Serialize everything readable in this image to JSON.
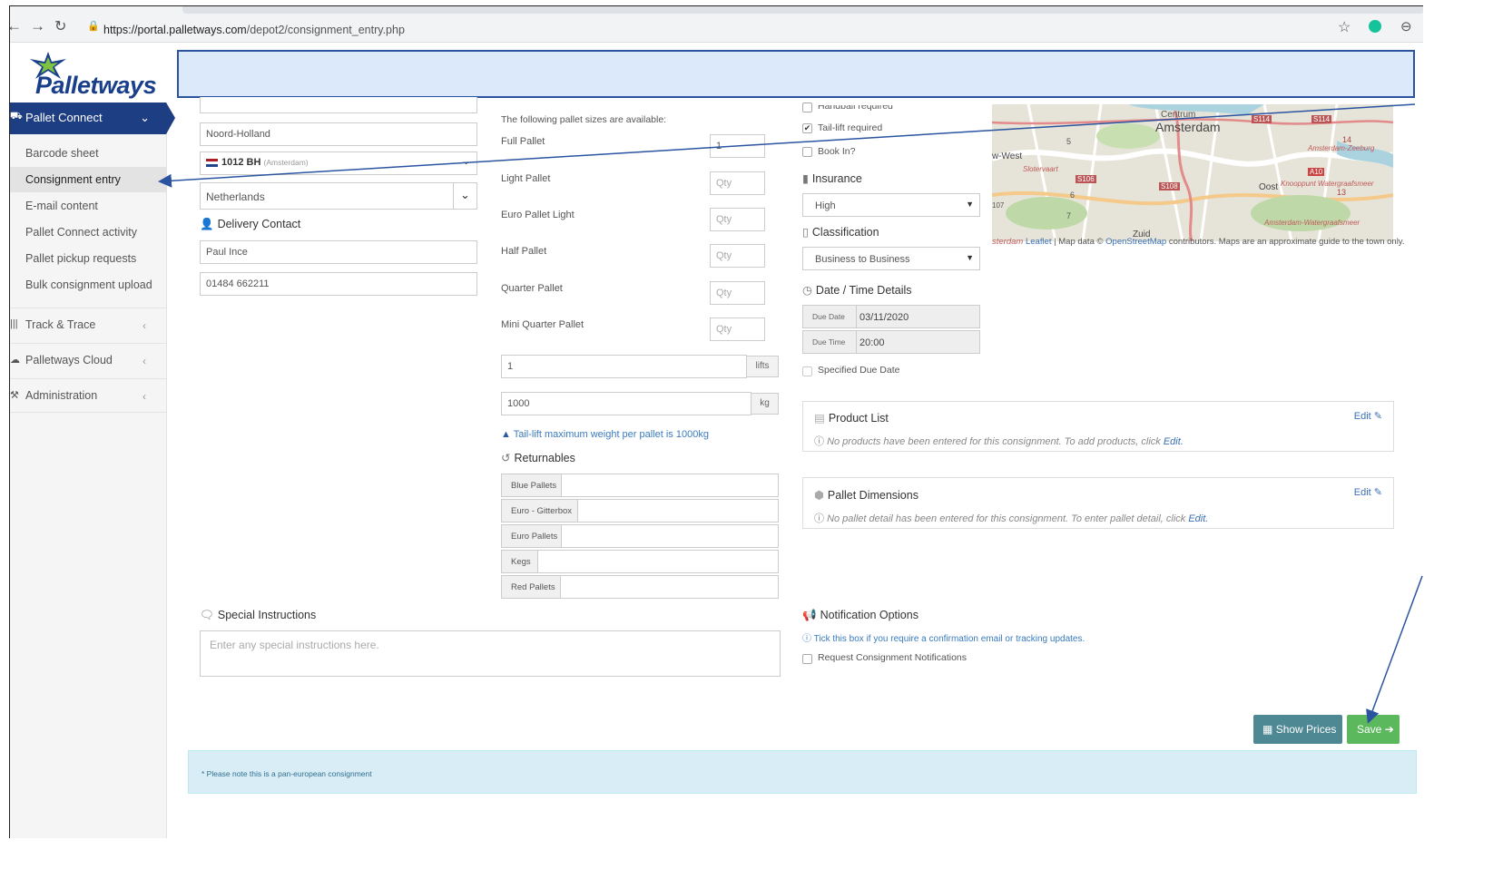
{
  "browser": {
    "url_host": "https://portal.palletways.com",
    "url_path": "/depot2/consignment_entry.php"
  },
  "logo": {
    "text": "Palletways"
  },
  "sidebar": {
    "header": "Pallet Connect",
    "items": [
      {
        "label": "Barcode sheet"
      },
      {
        "label": "Consignment entry"
      },
      {
        "label": "E-mail content"
      },
      {
        "label": "Pallet Connect activity"
      },
      {
        "label": "Pallet pickup requests"
      },
      {
        "label": "Bulk consignment upload"
      }
    ],
    "sections": [
      {
        "label": "Track & Trace"
      },
      {
        "label": "Palletways Cloud"
      },
      {
        "label": "Administration"
      }
    ]
  },
  "address": {
    "region": "Noord-Holland",
    "postcode": "1012 BH",
    "postcode_city": "(Amsterdam)",
    "country": "Netherlands"
  },
  "delivery_contact": {
    "heading": "Delivery Contact",
    "name": "Paul Ince",
    "phone": "01484 662211"
  },
  "pallets": {
    "intro": "The following pallet sizes are available:",
    "sizes": [
      {
        "label": "Full Pallet",
        "value": "1"
      },
      {
        "label": "Light Pallet",
        "placeholder": "Qty"
      },
      {
        "label": "Euro Pallet Light",
        "placeholder": "Qty"
      },
      {
        "label": "Half Pallet",
        "placeholder": "Qty"
      },
      {
        "label": "Quarter Pallet",
        "placeholder": "Qty"
      },
      {
        "label": "Mini Quarter Pallet",
        "placeholder": "Qty"
      }
    ],
    "lifts_value": "1",
    "lifts_unit": "lifts",
    "weight_value": "1000",
    "weight_unit": "kg",
    "warning": "Tail-lift maximum weight per pallet is 1000kg"
  },
  "returnables": {
    "heading": "Returnables",
    "items": [
      {
        "label": "Blue Pallets"
      },
      {
        "label": "Euro - Gitterbox"
      },
      {
        "label": "Euro Pallets"
      },
      {
        "label": "Kegs"
      },
      {
        "label": "Red Pallets"
      }
    ]
  },
  "options": {
    "handball": "Handball required",
    "taillift": "Tail-lift required",
    "bookin": "Book In?"
  },
  "insurance": {
    "heading": "Insurance",
    "value": "High"
  },
  "classification": {
    "heading": "Classification",
    "value": "Business to Business"
  },
  "datetime": {
    "heading": "Date / Time Details",
    "due_date_label": "Due Date",
    "due_date": "03/11/2020",
    "due_time_label": "Due Time",
    "due_time": "20:00",
    "specified_label": "Specified Due Date"
  },
  "product_list": {
    "heading": "Product List",
    "edit": "Edit",
    "message": "No products have been entered for this consignment. To add products, click",
    "link": "Edit."
  },
  "pallet_dimensions": {
    "heading": "Pallet Dimensions",
    "edit": "Edit",
    "message": "No pallet detail has been entered for this consignment. To enter pallet detail, click",
    "link": "Edit."
  },
  "map": {
    "labels": {
      "centrum": "Centrum",
      "amsterdam": "Amsterdam",
      "west": "w-West",
      "slotervaart": "Slotervaart",
      "oost": "Oost",
      "zuid": "Zuid",
      "zeeburg": "Amsterdam-Zeeburg",
      "watergraafsmeer": "Knooppunt Watergraafsmeer",
      "am_watergraafsmeer": "Amsterdam-Watergraafsmeer",
      "a10": "A10",
      "s114": "S114",
      "s106": "S106",
      "s108": "S108",
      "n14": "14",
      "n13": "13",
      "n5": "5",
      "n6": "6",
      "n7": "7",
      "n107": "107"
    },
    "attrib_prefix": "sterdam",
    "attrib_leaflet": "Leaflet",
    "attrib_mapdata": "| Map data ©",
    "attrib_osm": "OpenStreetMap",
    "attrib_rest": "contributors. Maps are an approximate guide to the town only."
  },
  "special_instructions": {
    "heading": "Special Instructions",
    "placeholder": "Enter any special instructions here."
  },
  "notifications": {
    "heading": "Notification Options",
    "info": "Tick this box if you require a confirmation email or tracking updates.",
    "checkbox_label": "Request Consignment Notifications"
  },
  "actions": {
    "show_prices": "Show Prices",
    "save": "Save"
  },
  "note": "* Please note this is a pan-european consignment",
  "colors": {
    "brand": "#1e3e83",
    "save": "#5cb85c",
    "show_prices": "#4d8893",
    "annotation": "#2a54a0"
  }
}
